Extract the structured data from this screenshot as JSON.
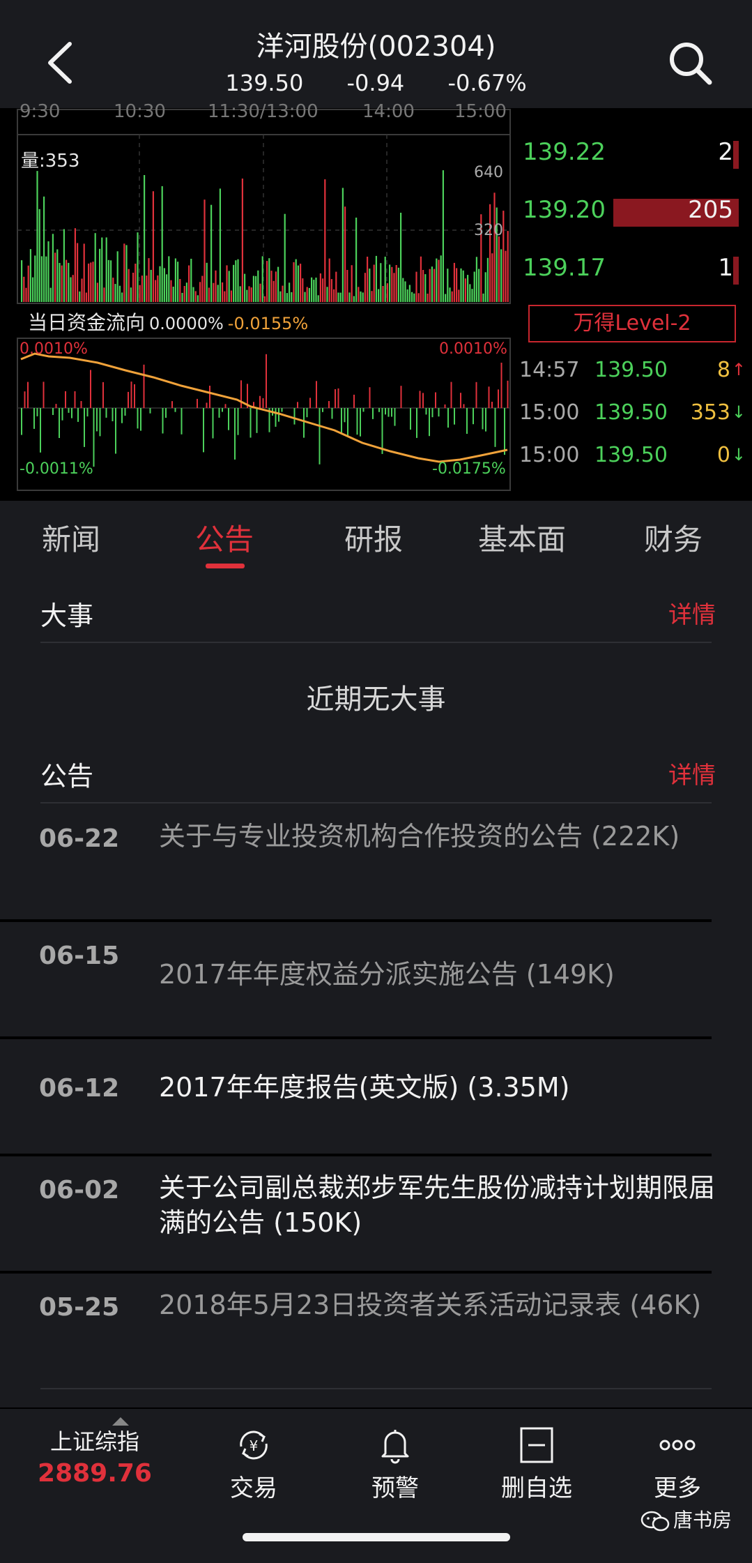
{
  "header": {
    "title": "洋河股份(002304)",
    "price": "139.50",
    "change": "-0.94",
    "change_pct": "-0.67%"
  },
  "chart": {
    "time_labels": [
      "9:30",
      "10:30",
      "11:30/13:00",
      "14:00",
      "15:00"
    ],
    "volume_label": "量:353",
    "volume_ticks": [
      "640",
      "320"
    ],
    "flow_title": "当日资金流向",
    "flow_pct_1": "0.0000%",
    "flow_pct_2": "-0.0155%",
    "flow_top_left": "0.0010%",
    "flow_top_right": "0.0010%",
    "flow_bottom_left": "-0.0011%",
    "flow_bottom_right": "-0.0175%",
    "colors": {
      "up": "#e0313b",
      "down": "#4cd15b",
      "line": "#f0a23a"
    }
  },
  "order_book": [
    {
      "price": "139.22",
      "qty": "2",
      "bar_fraction": 0.02
    },
    {
      "price": "139.20",
      "qty": "205",
      "bar_fraction": 0.58
    },
    {
      "price": "139.17",
      "qty": "1",
      "bar_fraction": 0.01
    }
  ],
  "level2_label": "万得Level-2",
  "ticks": [
    {
      "time": "14:57",
      "price": "139.50",
      "vol": "8",
      "arrow": "↑",
      "arrow_color": "#e0313b"
    },
    {
      "time": "15:00",
      "price": "139.50",
      "vol": "353",
      "arrow": "↓",
      "arrow_color": "#4cd15b"
    },
    {
      "time": "15:00",
      "price": "139.50",
      "vol": "0",
      "arrow": "↓",
      "arrow_color": "#4cd15b"
    }
  ],
  "tabs": [
    "新闻",
    "公告",
    "研报",
    "基本面",
    "财务"
  ],
  "active_tab": 1,
  "events": {
    "title": "大事",
    "detail": "详情",
    "empty_text": "近期无大事"
  },
  "announcements": {
    "title": "公告",
    "detail": "详情",
    "items": [
      {
        "date": "06-22",
        "text": "关于与专业投资机构合作投资的公告 (222K)",
        "bright": false
      },
      {
        "date": "06-15",
        "text": "2017年年度权益分派实施公告 (149K)",
        "bright": false
      },
      {
        "date": "06-12",
        "text": "2017年年度报告(英文版) (3.35M)",
        "bright": true
      },
      {
        "date": "06-02",
        "text": "关于公司副总裁郑步军先生股份减持计划期限届满的公告 (150K)",
        "bright": true
      },
      {
        "date": "05-25",
        "text": "2018年5月23日投资者关系活动记录表 (46K)",
        "bright": false
      }
    ]
  },
  "bottom_nav": {
    "index_name": "上证综指",
    "index_value": "2889.76",
    "items": [
      {
        "label": "交易",
        "icon": "yen-cycle-icon"
      },
      {
        "label": "预警",
        "icon": "bell-icon"
      },
      {
        "label": "删自选",
        "icon": "remove-watchlist-icon"
      },
      {
        "label": "更多",
        "icon": "more-dots-icon"
      }
    ]
  },
  "watermark": "唐书房"
}
